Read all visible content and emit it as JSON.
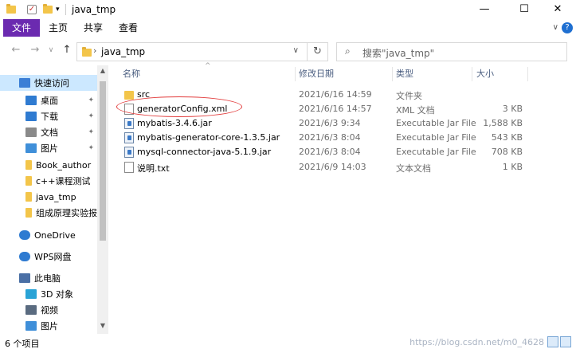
{
  "window": {
    "title": "java_tmp",
    "minimize": "—",
    "maximize": "☐",
    "close": "✕"
  },
  "ribbon": {
    "tabs": [
      "文件",
      "主页",
      "共享",
      "查看"
    ]
  },
  "address": {
    "path": "java_tmp",
    "search_placeholder": "搜索\"java_tmp\""
  },
  "sidebar": {
    "items": [
      {
        "label": "快速访问",
        "icon": "star-icon",
        "selected": true
      },
      {
        "label": "桌面",
        "icon": "desktop-icon",
        "pinned": true
      },
      {
        "label": "下载",
        "icon": "download-icon",
        "pinned": true
      },
      {
        "label": "文档",
        "icon": "documents-icon",
        "pinned": true
      },
      {
        "label": "图片",
        "icon": "pictures-icon",
        "pinned": true
      },
      {
        "label": "Book_author",
        "icon": "folder-icon"
      },
      {
        "label": "c++课程测试",
        "icon": "folder-icon"
      },
      {
        "label": "java_tmp",
        "icon": "folder-icon"
      },
      {
        "label": "组成原理实验报告",
        "icon": "folder-icon"
      },
      {
        "label": "OneDrive",
        "icon": "cloud-icon"
      },
      {
        "label": "WPS网盘",
        "icon": "cloud-icon"
      },
      {
        "label": "此电脑",
        "icon": "computer-icon"
      },
      {
        "label": "3D 对象",
        "icon": "cube-icon"
      },
      {
        "label": "视频",
        "icon": "video-icon"
      },
      {
        "label": "图片",
        "icon": "pictures-icon"
      }
    ]
  },
  "columns": {
    "name": "名称",
    "date": "修改日期",
    "type": "类型",
    "size": "大小"
  },
  "files": [
    {
      "name": "src",
      "date": "2021/6/16 14:59",
      "type": "文件夹",
      "size": "",
      "icon": "folder-icon"
    },
    {
      "name": "generatorConfig.xml",
      "date": "2021/6/16 14:57",
      "type": "XML 文档",
      "size": "3 KB",
      "icon": "xml-file-icon"
    },
    {
      "name": "mybatis-3.4.6.jar",
      "date": "2021/6/3 9:34",
      "type": "Executable Jar File",
      "size": "1,588 KB",
      "icon": "jar-file-icon"
    },
    {
      "name": "mybatis-generator-core-1.3.5.jar",
      "date": "2021/6/3 8:04",
      "type": "Executable Jar File",
      "size": "543 KB",
      "icon": "jar-file-icon"
    },
    {
      "name": "mysql-connector-java-5.1.9.jar",
      "date": "2021/6/3 8:04",
      "type": "Executable Jar File",
      "size": "708 KB",
      "icon": "jar-file-icon"
    },
    {
      "name": "说明.txt",
      "date": "2021/6/9 14:03",
      "type": "文本文档",
      "size": "1 KB",
      "icon": "text-file-icon"
    }
  ],
  "status": {
    "count": "6 个项目",
    "watermark": "https://blog.csdn.net/m0_4628"
  },
  "colors": {
    "accent": "#6b2ab0",
    "selection": "#cce8ff",
    "highlight_circle": "#e23b3b"
  }
}
